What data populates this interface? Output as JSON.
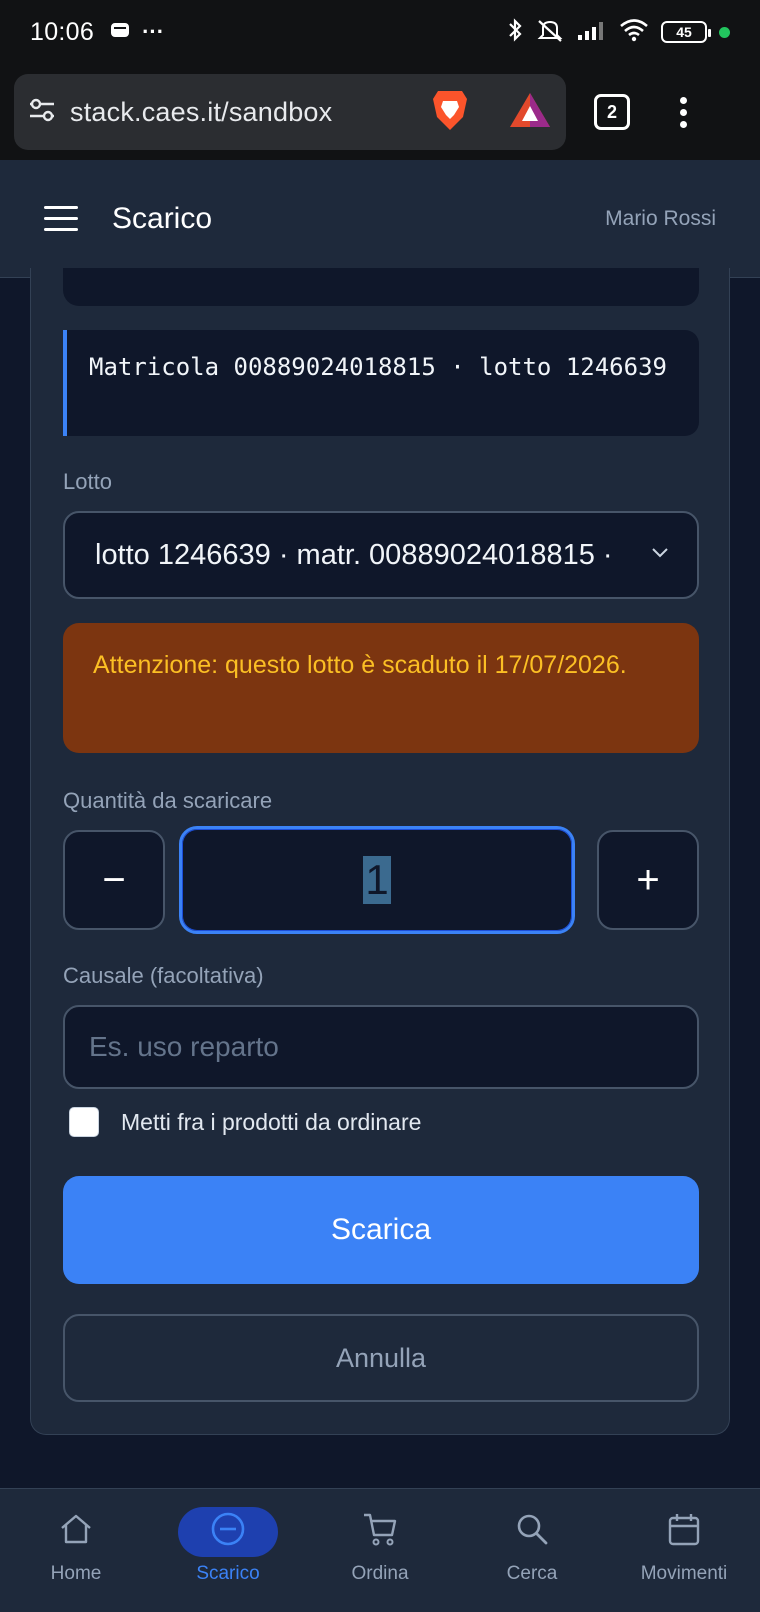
{
  "status_bar": {
    "time": "10:06",
    "more": "···",
    "battery": "45"
  },
  "browser": {
    "url": "stack.caes.it/sandbox",
    "tab_count": "2"
  },
  "header": {
    "title": "Scarico",
    "user": "Mario Rossi"
  },
  "form": {
    "matricola_info": "Matricola 00889024018815 · lotto 1246639",
    "lotto_label": "Lotto",
    "lotto_selected": "lotto 1246639 · matr. 00889024018815 ·",
    "warning": "Attenzione: questo lotto è scaduto il 17/07/2026.",
    "quantity_label": "Quantità da scaricare",
    "minus": "−",
    "plus": "+",
    "quantity_value": "1",
    "causale_label": "Causale (facoltativa)",
    "causale_placeholder": "Es. uso reparto",
    "checkbox_label": "Metti fra i prodotti da ordinare",
    "checkbox_checked": false,
    "submit_label": "Scarica",
    "cancel_label": "Annulla"
  },
  "nav": {
    "items": [
      {
        "label": "Home",
        "icon": "home-icon"
      },
      {
        "label": "Scarico",
        "icon": "minus-circle-icon",
        "active": true
      },
      {
        "label": "Ordina",
        "icon": "cart-icon"
      },
      {
        "label": "Cerca",
        "icon": "search-icon"
      },
      {
        "label": "Movimenti",
        "icon": "calendar-icon"
      }
    ]
  },
  "colors": {
    "accent": "#3b82f6",
    "warning_bg": "#7c3510",
    "warning_text": "#fbbf24",
    "background": "#0f172a",
    "surface": "#1e293b"
  }
}
